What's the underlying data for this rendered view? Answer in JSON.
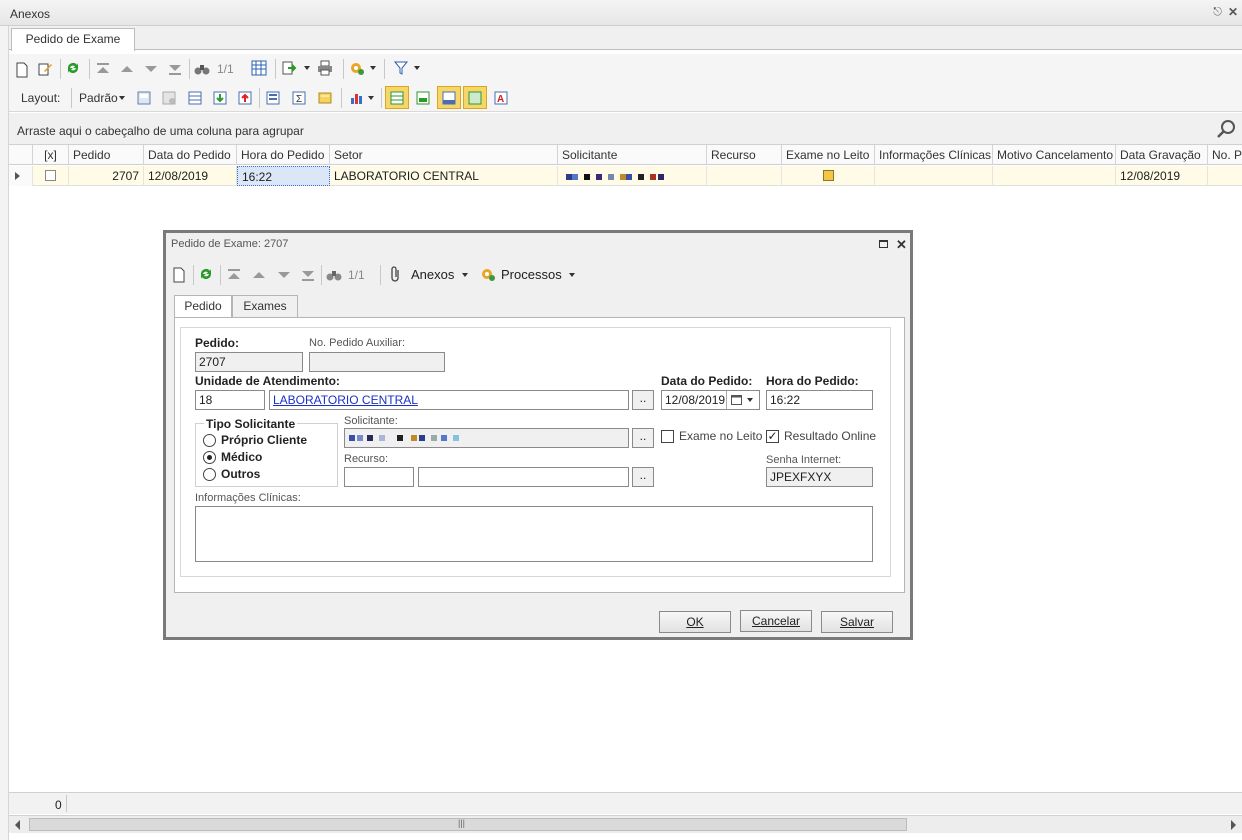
{
  "panel": {
    "title": "Anexos",
    "pin": "⌘",
    "close": "✕"
  },
  "doc_tab": {
    "label": "Pedido de Exame"
  },
  "toolbar": {
    "counter": "1/1",
    "layout_label": "Layout:",
    "layout_value": "Padrão"
  },
  "group_hint": "Arraste aqui o cabeçalho de uma coluna para agrupar",
  "grid": {
    "columns": [
      "[x]",
      "Pedido",
      "Data do Pedido",
      "Hora do Pedido",
      "Setor",
      "Solicitante",
      "Recurso",
      "Exame no Leito",
      "Informações Clínicas",
      "Motivo Cancelamento",
      "Data Gravação",
      "No. Pe"
    ],
    "row": {
      "pedido": "2707",
      "data": "12/08/2019",
      "hora": "16:22",
      "setor": "LABORATORIO CENTRAL",
      "recurso": "",
      "info": "",
      "motivo": "",
      "data_gravacao": "12/08/2019"
    }
  },
  "footer": {
    "count": "0",
    "scroll_grip": "|||"
  },
  "dialog": {
    "title": "Pedido de Exame: 2707",
    "counter": "1/1",
    "anexos_label": "Anexos",
    "processos_label": "Processos",
    "tabs": [
      "Pedido",
      "Exames"
    ],
    "form": {
      "pedido_label": "Pedido:",
      "pedido_value": "2707",
      "aux_label": "No. Pedido Auxiliar:",
      "aux_value": "",
      "unidade_label": "Unidade de Atendimento:",
      "unidade_code": "18",
      "unidade_name": "LABORATORIO CENTRAL",
      "data_label": "Data do Pedido:",
      "data_value": "12/08/2019",
      "hora_label": "Hora do Pedido:",
      "hora_value": "16:22",
      "tipo_label": "Tipo Solicitante",
      "tipo_options": [
        "Próprio Cliente",
        "Médico",
        "Outros"
      ],
      "tipo_selected": "Médico",
      "solicitante_label": "Solicitante:",
      "recurso_label": "Recurso:",
      "exame_leito_label": "Exame no Leito",
      "resultado_online_label": "Resultado Online",
      "senha_label": "Senha Internet:",
      "senha_value": "JPEXFXYX",
      "info_label": "Informações Clínicas:",
      "ellipsis": "..",
      "checkmark": "✓"
    },
    "buttons": {
      "ok": "OK",
      "cancelar": "Cancelar",
      "salvar": "Salvar"
    }
  },
  "colors": {
    "accent_yellow": "#f6c544",
    "link_blue": "#1a31c9",
    "window_border": "#7a7a7a"
  }
}
